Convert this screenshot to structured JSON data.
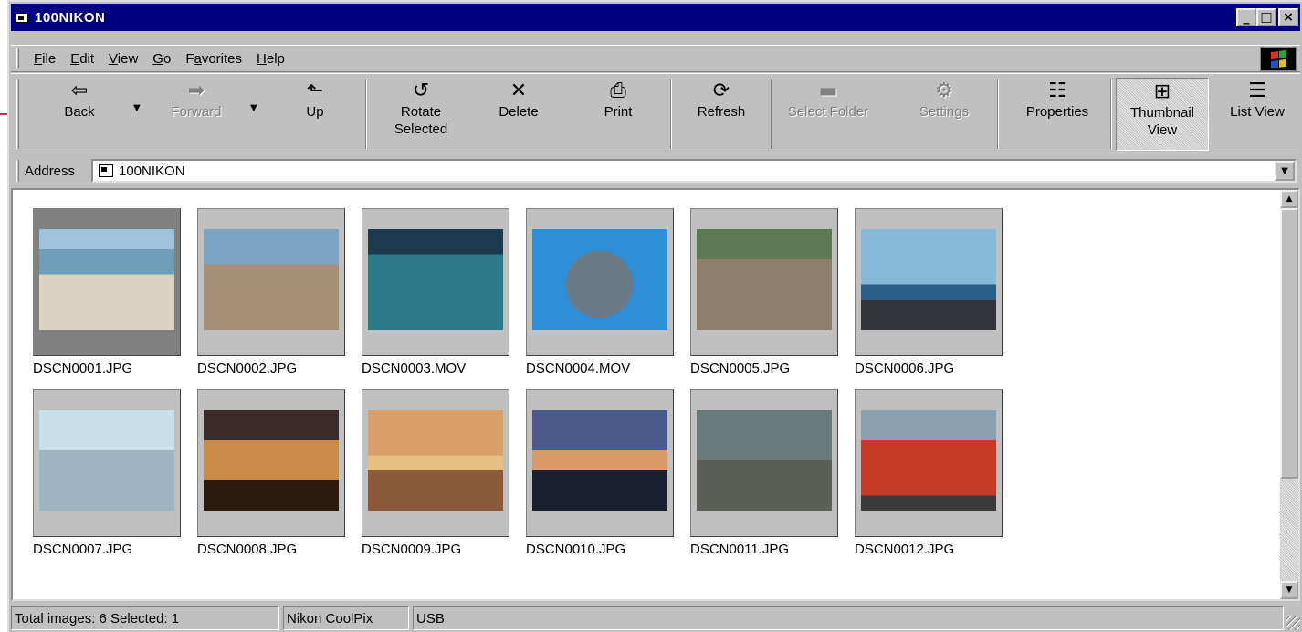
{
  "window": {
    "title": "100NIKON"
  },
  "title_buttons": {
    "minimize": "_",
    "maximize": "□",
    "close": "×"
  },
  "menu": [
    "File",
    "Edit",
    "View",
    "Go",
    "Favorites",
    "Help"
  ],
  "menu_mnemonics": [
    "F",
    "E",
    "V",
    "G",
    "a",
    "H"
  ],
  "toolbar": {
    "back": {
      "label": "Back",
      "icon": "back-arrow-icon",
      "glyph": "⇦"
    },
    "forward": {
      "label": "Forward",
      "icon": "forward-arrow-icon",
      "glyph": "➡"
    },
    "up": {
      "label": "Up",
      "icon": "up-folder-icon",
      "glyph": "⬑"
    },
    "rotate": {
      "label1": "Rotate",
      "label2": "Selected",
      "icon": "rotate-icon",
      "glyph": "↺"
    },
    "delete": {
      "label": "Delete",
      "icon": "delete-icon",
      "glyph": "✕"
    },
    "print": {
      "label": "Print",
      "icon": "printer-icon",
      "glyph": "⎙"
    },
    "refresh": {
      "label": "Refresh",
      "icon": "refresh-icon",
      "glyph": "⟳"
    },
    "select_folder": {
      "label": "Select Folder",
      "icon": "folder-icon",
      "glyph": "▬"
    },
    "settings": {
      "label": "Settings",
      "icon": "camera-settings-icon",
      "glyph": "⚙"
    },
    "properties": {
      "label": "Properties",
      "icon": "properties-icon",
      "glyph": "☷"
    },
    "thumbnail": {
      "label1": "Thumbnail",
      "label2": "View",
      "icon": "thumbnail-view-icon",
      "glyph": "⊞"
    },
    "list": {
      "label": "List View",
      "icon": "list-view-icon",
      "glyph": "☰"
    },
    "dropdown_glyph": "▼"
  },
  "address": {
    "label": "Address",
    "value": "100NIKON",
    "drop_glyph": "▼"
  },
  "files": [
    {
      "name": "DSCN0001.JPG",
      "selected": true
    },
    {
      "name": "DSCN0002.JPG",
      "selected": false
    },
    {
      "name": "DSCN0003.MOV",
      "selected": false
    },
    {
      "name": "DSCN0004.MOV",
      "selected": false
    },
    {
      "name": "DSCN0005.JPG",
      "selected": false
    },
    {
      "name": "DSCN0006.JPG",
      "selected": false
    },
    {
      "name": "DSCN0007.JPG",
      "selected": false
    },
    {
      "name": "DSCN0008.JPG",
      "selected": false
    },
    {
      "name": "DSCN0009.JPG",
      "selected": false
    },
    {
      "name": "DSCN0010.JPG",
      "selected": false
    },
    {
      "name": "DSCN0011.JPG",
      "selected": false
    },
    {
      "name": "DSCN0012.JPG",
      "selected": false
    }
  ],
  "scroll": {
    "up_glyph": "▲",
    "down_glyph": "▼"
  },
  "status": {
    "counts": "Total images: 6   Selected: 1",
    "camera": "Nikon CoolPix",
    "connection": "USB"
  },
  "colors": {
    "titlebar": "#000080",
    "chrome": "#c0c0c0",
    "callout": "#d6206a"
  }
}
